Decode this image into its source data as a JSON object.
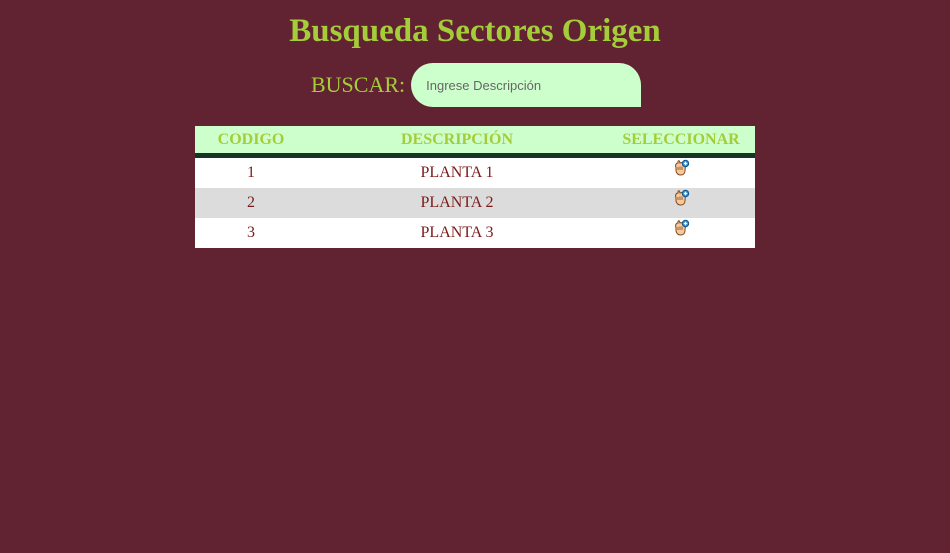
{
  "page": {
    "title": "Busqueda Sectores Origen"
  },
  "search": {
    "label": "BUSCAR:",
    "placeholder": "Ingrese Descripción",
    "value": ""
  },
  "table": {
    "headers": [
      "CODIGO",
      "DESCRIPCIÓN",
      "SELECCIONAR"
    ],
    "rows": [
      {
        "codigo": "1",
        "descripcion": "PLANTA 1",
        "icon": "select-hand-icon"
      },
      {
        "codigo": "2",
        "descripcion": "PLANTA 2",
        "icon": "select-hand-icon"
      },
      {
        "codigo": "3",
        "descripcion": "PLANTA 3",
        "icon": "select-hand-icon"
      }
    ]
  },
  "colors": {
    "background": "#612232",
    "accent_text": "#a5cd39",
    "header_bg": "#cdffcc",
    "header_border": "#163529",
    "row_text": "#7a1a1a",
    "row_alt_bg": "#dcdcdc"
  }
}
